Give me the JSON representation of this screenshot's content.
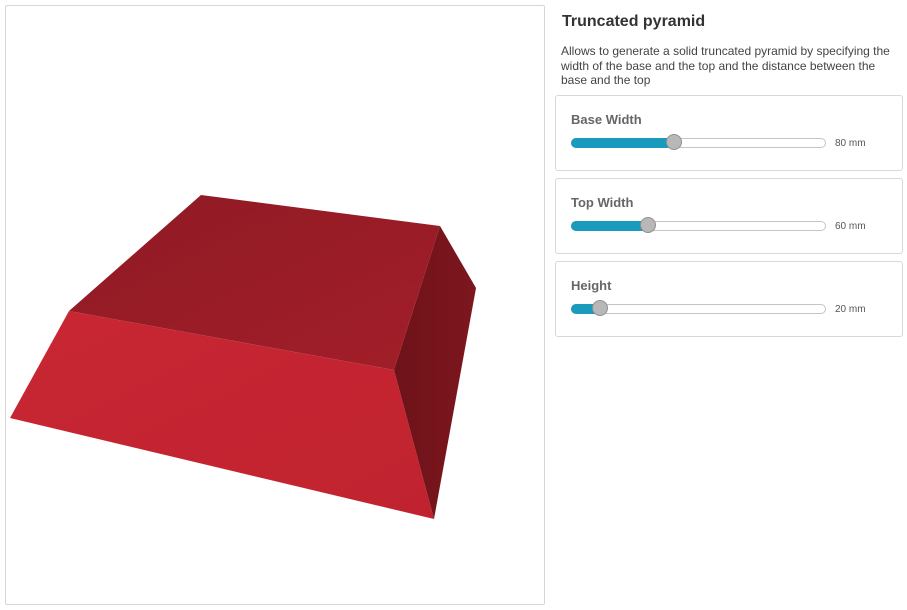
{
  "panel": {
    "title": "Truncated pyramid",
    "description": "Allows to generate a solid truncated pyramid by specifying the width of the base and the top and the distance between the base and the top"
  },
  "parameters": [
    {
      "label": "Base Width",
      "value": 80,
      "unit": "mm",
      "display": "80 mm",
      "fraction": 0.405
    },
    {
      "label": "Top Width",
      "value": 60,
      "unit": "mm",
      "display": "60 mm",
      "fraction": 0.3
    },
    {
      "label": "Height",
      "value": 20,
      "unit": "mm",
      "display": "20 mm",
      "fraction": 0.11
    }
  ],
  "colors": {
    "accent": "#1a9bbd",
    "model_top": "#9a1c26",
    "model_front": "#c72633",
    "model_side": "#76141b"
  }
}
